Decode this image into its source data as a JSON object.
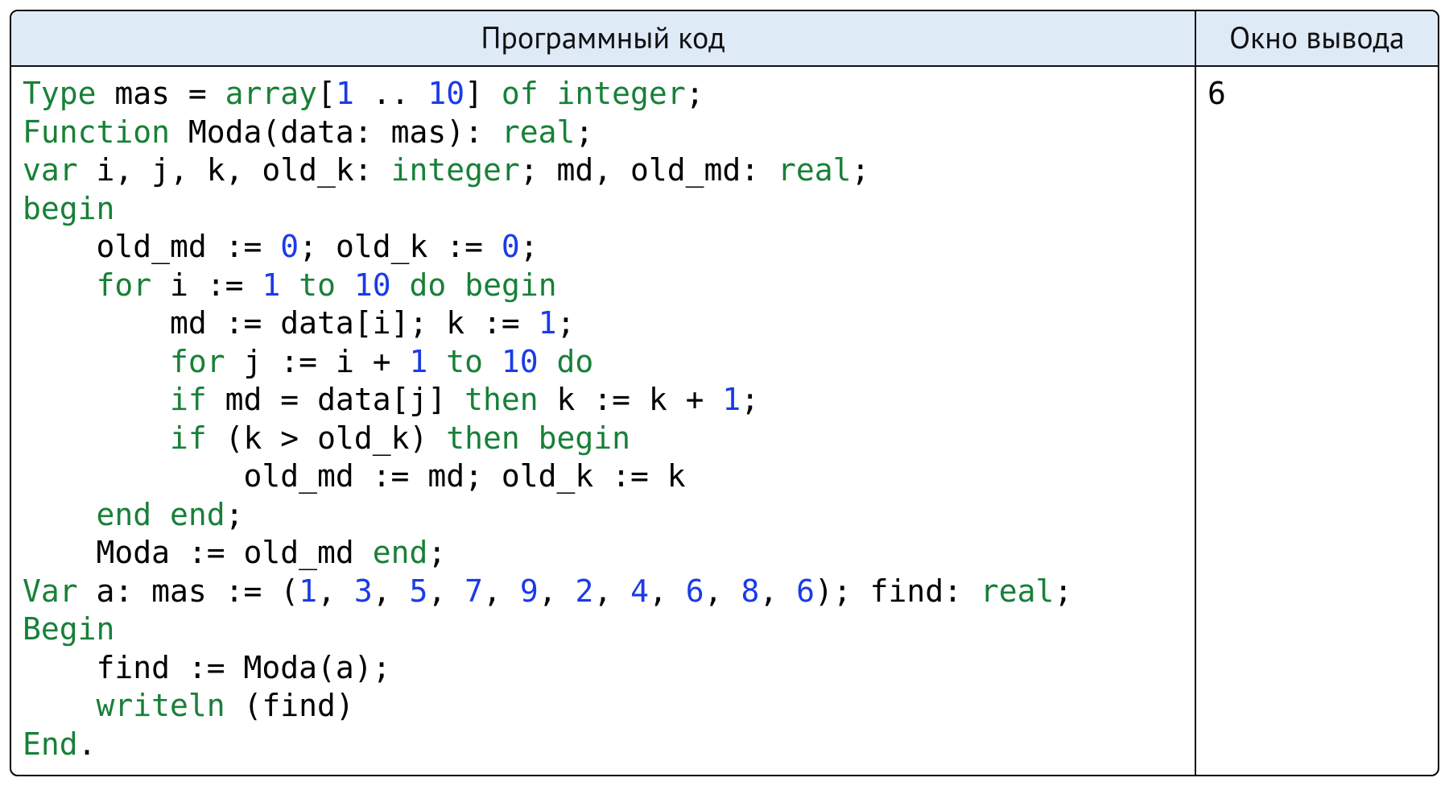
{
  "headers": {
    "code": "Программный код",
    "output": "Окно вывода"
  },
  "output": "6",
  "code": {
    "tokens": [
      [
        [
          "Type",
          "kw"
        ],
        [
          " mas = ",
          ""
        ],
        [
          "array",
          "kw"
        ],
        [
          "[",
          ""
        ],
        [
          "1",
          "num"
        ],
        [
          " .. ",
          ""
        ],
        [
          "10",
          "num"
        ],
        [
          "] ",
          ""
        ],
        [
          "of",
          "kw"
        ],
        [
          " ",
          ""
        ],
        [
          "integer",
          "kw"
        ],
        [
          ";",
          ""
        ]
      ],
      [
        [
          "Function",
          "kw"
        ],
        [
          " Moda(data: mas): ",
          ""
        ],
        [
          "real",
          "kw"
        ],
        [
          ";",
          ""
        ]
      ],
      [
        [
          "var",
          "kw"
        ],
        [
          " i, j, k, old_k: ",
          ""
        ],
        [
          "integer",
          "kw"
        ],
        [
          "; md, old_md: ",
          ""
        ],
        [
          "real",
          "kw"
        ],
        [
          ";",
          ""
        ]
      ],
      [
        [
          "begin",
          "kw"
        ]
      ],
      [
        [
          "    old_md := ",
          ""
        ],
        [
          "0",
          "num"
        ],
        [
          "; old_k := ",
          ""
        ],
        [
          "0",
          "num"
        ],
        [
          ";",
          ""
        ]
      ],
      [
        [
          "    ",
          ""
        ],
        [
          "for",
          "kw"
        ],
        [
          " i := ",
          ""
        ],
        [
          "1",
          "num"
        ],
        [
          " ",
          ""
        ],
        [
          "to",
          "kw"
        ],
        [
          " ",
          ""
        ],
        [
          "10",
          "num"
        ],
        [
          " ",
          ""
        ],
        [
          "do",
          "kw"
        ],
        [
          " ",
          ""
        ],
        [
          "begin",
          "kw"
        ]
      ],
      [
        [
          "        md := data[i]; k := ",
          ""
        ],
        [
          "1",
          "num"
        ],
        [
          ";",
          ""
        ]
      ],
      [
        [
          "        ",
          ""
        ],
        [
          "for",
          "kw"
        ],
        [
          " j := i + ",
          ""
        ],
        [
          "1",
          "num"
        ],
        [
          " ",
          ""
        ],
        [
          "to",
          "kw"
        ],
        [
          " ",
          ""
        ],
        [
          "10",
          "num"
        ],
        [
          " ",
          ""
        ],
        [
          "do",
          "kw"
        ]
      ],
      [
        [
          "        ",
          ""
        ],
        [
          "if",
          "kw"
        ],
        [
          " md = data[j] ",
          ""
        ],
        [
          "then",
          "kw"
        ],
        [
          " k := k + ",
          ""
        ],
        [
          "1",
          "num"
        ],
        [
          ";",
          ""
        ]
      ],
      [
        [
          "        ",
          ""
        ],
        [
          "if",
          "kw"
        ],
        [
          " (k > old_k) ",
          ""
        ],
        [
          "then",
          "kw"
        ],
        [
          " ",
          ""
        ],
        [
          "begin",
          "kw"
        ]
      ],
      [
        [
          "            old_md := md; old_k := k",
          ""
        ]
      ],
      [
        [
          "    ",
          ""
        ],
        [
          "end",
          "kw"
        ],
        [
          " ",
          ""
        ],
        [
          "end",
          "kw"
        ],
        [
          ";",
          ""
        ]
      ],
      [
        [
          "    Moda := old_md ",
          ""
        ],
        [
          "end",
          "kw"
        ],
        [
          ";",
          ""
        ]
      ],
      [
        [
          "Var",
          "kw"
        ],
        [
          " a: mas := (",
          ""
        ],
        [
          "1",
          "num"
        ],
        [
          ", ",
          ""
        ],
        [
          "3",
          "num"
        ],
        [
          ", ",
          ""
        ],
        [
          "5",
          "num"
        ],
        [
          ", ",
          ""
        ],
        [
          "7",
          "num"
        ],
        [
          ", ",
          ""
        ],
        [
          "9",
          "num"
        ],
        [
          ", ",
          ""
        ],
        [
          "2",
          "num"
        ],
        [
          ", ",
          ""
        ],
        [
          "4",
          "num"
        ],
        [
          ", ",
          ""
        ],
        [
          "6",
          "num"
        ],
        [
          ", ",
          ""
        ],
        [
          "8",
          "num"
        ],
        [
          ", ",
          ""
        ],
        [
          "6",
          "num"
        ],
        [
          "); find: ",
          ""
        ],
        [
          "real",
          "kw"
        ],
        [
          ";",
          ""
        ]
      ],
      [
        [
          "Begin",
          "kw"
        ]
      ],
      [
        [
          "    find := Moda(a);",
          ""
        ]
      ],
      [
        [
          "    ",
          ""
        ],
        [
          "writeln",
          "kw"
        ],
        [
          " (find)",
          ""
        ]
      ],
      [
        [
          "End",
          "kw"
        ],
        [
          ".",
          ""
        ]
      ]
    ]
  }
}
